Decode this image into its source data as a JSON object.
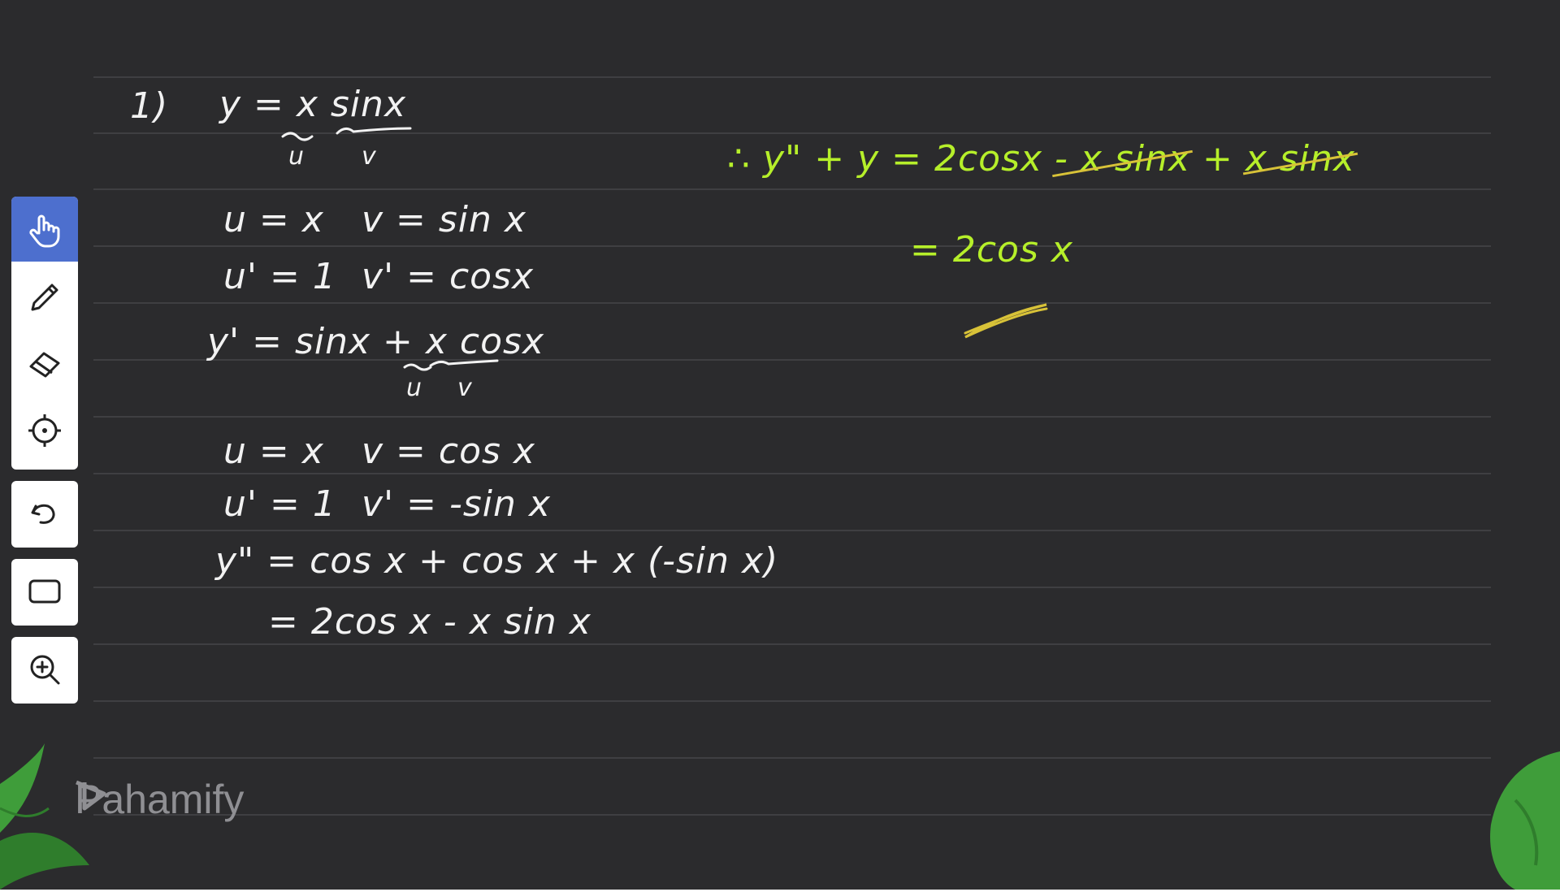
{
  "brand": {
    "logo_text": "Pahamify"
  },
  "toolbar": {
    "tools": [
      {
        "name": "hand",
        "icon": "hand-pointer-icon",
        "active": true
      },
      {
        "name": "pen",
        "icon": "pen-icon",
        "active": false
      },
      {
        "name": "eraser",
        "icon": "eraser-icon",
        "active": false
      },
      {
        "name": "laser",
        "icon": "crosshair-icon",
        "active": false
      },
      {
        "name": "undo",
        "icon": "undo-icon",
        "active": false
      },
      {
        "name": "shape",
        "icon": "rectangle-icon",
        "active": false
      },
      {
        "name": "zoom",
        "icon": "zoom-in-icon",
        "active": false
      }
    ],
    "accent": "#4d6fce"
  },
  "colors": {
    "chalk_white": "#f2f2f2",
    "chalk_green": "#b6ef2a",
    "strike_yellow": "#d8c238",
    "board": "#2b2b2d"
  },
  "board": {
    "left": {
      "problem_number": "1)",
      "eq1": "y = x sinx",
      "uv1": [
        "u",
        "v"
      ],
      "u1": "u = x",
      "v1": "v = sin x",
      "du1": "u' = 1",
      "dv1": "v' = cosx",
      "yprime": "y' = sinx + x cosx",
      "uv2": [
        "u",
        "v"
      ],
      "u2": "u = x",
      "v2": "v = cos x",
      "du2": "u' = 1",
      "dv2": "v' = -sin x",
      "ysecond": "y\" = cos x + cos x + x (-sin x)",
      "ysecond2": "= 2cos x - x sin x"
    },
    "right": {
      "result_prefix": "∴ y\" + y = 2cosx ",
      "struck1": "- x sinx",
      "plus": " + ",
      "struck2": "x sinx",
      "result2": "= 2cos x"
    }
  }
}
